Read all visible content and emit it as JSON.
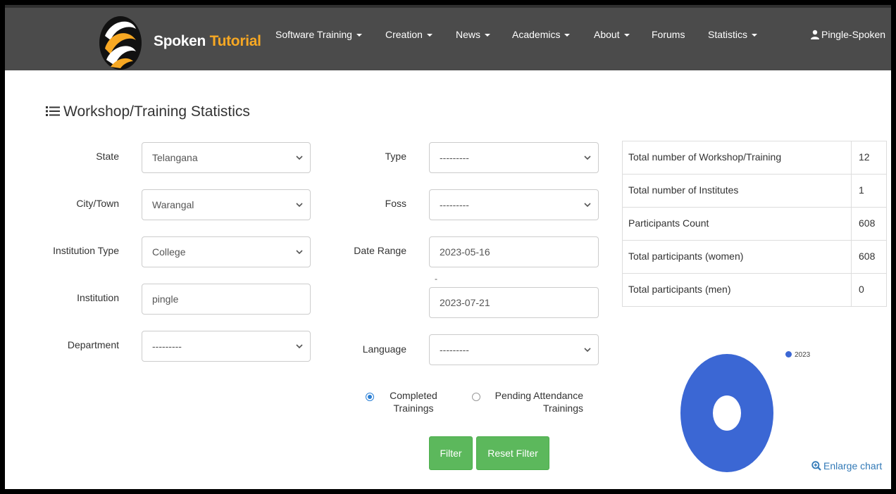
{
  "navbar": {
    "brand_part1": "Spoken",
    "brand_part2": "Tutorial",
    "items": [
      {
        "label": "Software Training",
        "dropdown": true
      },
      {
        "label": "Creation",
        "dropdown": true
      },
      {
        "label": "News",
        "dropdown": true
      },
      {
        "label": "Academics",
        "dropdown": true
      },
      {
        "label": "About",
        "dropdown": true
      },
      {
        "label": "Forums",
        "dropdown": false
      },
      {
        "label": "Statistics",
        "dropdown": true
      }
    ],
    "user": "Pingle-Spoken"
  },
  "page": {
    "title": "Workshop/Training Statistics"
  },
  "form": {
    "state": {
      "label": "State",
      "value": "Telangana"
    },
    "city": {
      "label": "City/Town",
      "value": "Warangal"
    },
    "institution_type": {
      "label": "Institution Type",
      "value": "College"
    },
    "institution": {
      "label": "Institution",
      "value": "pingle"
    },
    "department": {
      "label": "Department",
      "value": "---------"
    },
    "type": {
      "label": "Type",
      "value": "---------"
    },
    "foss": {
      "label": "Foss",
      "value": "---------"
    },
    "date_range": {
      "label": "Date Range",
      "from": "2023-05-16",
      "separator": "-",
      "to": "2023-07-21"
    },
    "language": {
      "label": "Language",
      "value": "---------"
    },
    "radio_completed": {
      "line1": "Completed",
      "line2": "Trainings",
      "selected": true
    },
    "radio_pending": {
      "line1": "Pending Attendance",
      "line2": "Trainings",
      "selected": false
    },
    "filter_label": "Filter",
    "reset_label": "Reset Filter"
  },
  "stats": [
    {
      "label": "Total number of Workshop/Training",
      "value": "12"
    },
    {
      "label": "Total number of Institutes",
      "value": "1"
    },
    {
      "label": "Participants Count",
      "value": "608"
    },
    {
      "label": "Total participants (women)",
      "value": "608"
    },
    {
      "label": "Total participants (men)",
      "value": "0"
    }
  ],
  "chart_data": {
    "type": "pie",
    "categories": [
      "2023"
    ],
    "values": [
      12
    ],
    "donut": true,
    "color": "#3b67d4",
    "legend": "top-right"
  },
  "enlarge_label": "Enlarge chart",
  "colors": {
    "navbar": "#4b4b4b",
    "brand_accent": "#f7a823",
    "button": "#5cb85c",
    "link": "#337ab7"
  }
}
